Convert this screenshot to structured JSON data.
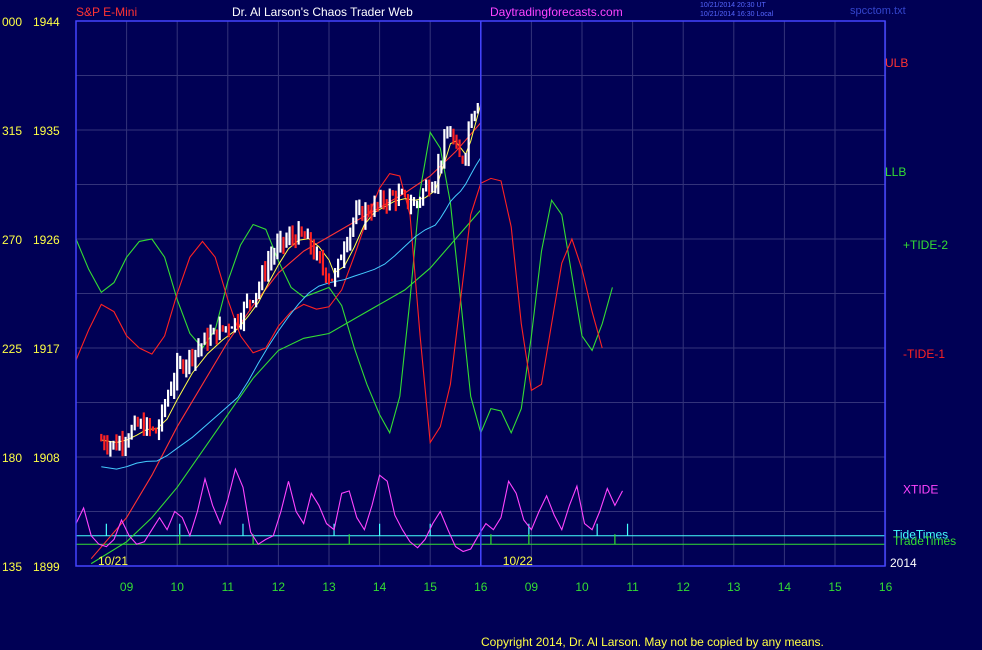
{
  "header": {
    "symbol": "S&P E-Mini",
    "site": "Dr. Al Larson's Chaos Trader Web",
    "url": "Daytradingforecasts.com",
    "stamp1": "10/21/2014 20:30 UT",
    "stamp2": "10/21/2014 16:30 Local",
    "file": "spcctom.txt"
  },
  "footer": {
    "copyright": "Copyright 2014, Dr. Al Larson. May not be copied by any means."
  },
  "colors": {
    "background": "#000055",
    "frame": "#4444ff",
    "grid": "#33337a",
    "axis_text": "#ffff44",
    "time_text": "#33dd33",
    "price_bar_up": "#ffffff",
    "price_bar_down": "#ff2222",
    "ulb": "#ff3333",
    "llb": "#33dd33",
    "tide_pos": "#33dd33",
    "tide_neg": "#ff2222",
    "xtide": "#ff44ff",
    "tide_times": "#44ffff",
    "trade_times": "#33dd33",
    "avg_yellow": "#ffff44",
    "avg_cyan": "#44ccff"
  },
  "chart_data": {
    "type": "line",
    "y_ticks": [
      {
        "left": "000",
        "price": "1944",
        "value": 1944
      },
      {
        "left": "315",
        "price": "1935",
        "value": 1935
      },
      {
        "left": "270",
        "price": "1926",
        "value": 1926
      },
      {
        "left": "225",
        "price": "1917",
        "value": 1917
      },
      {
        "left": "180",
        "price": "1908",
        "value": 1908
      },
      {
        "left": "135",
        "price": "1899",
        "value": 1899
      }
    ],
    "ylim": [
      1899,
      1944
    ],
    "x_ticks": [
      "09",
      "10",
      "11",
      "12",
      "13",
      "14",
      "15",
      "16",
      "09",
      "10",
      "11",
      "12",
      "13",
      "14",
      "15",
      "16"
    ],
    "date_labels": [
      "10/21",
      "10/22"
    ],
    "year_label": "2014",
    "divider_at": 8,
    "grid": true,
    "price": {
      "description": "intraday close path from 08:30 on 10/21",
      "points": [
        [
          8.5,
          1909.4
        ],
        [
          8.8,
          1909.0
        ],
        [
          9.0,
          1909.8
        ],
        [
          9.2,
          1910.6
        ],
        [
          9.4,
          1910.4
        ],
        [
          9.6,
          1910.0
        ],
        [
          9.8,
          1913.0
        ],
        [
          10.0,
          1915.2
        ],
        [
          10.3,
          1916.6
        ],
        [
          10.6,
          1917.8
        ],
        [
          10.9,
          1918.6
        ],
        [
          11.2,
          1919.4
        ],
        [
          11.4,
          1920.8
        ],
        [
          11.6,
          1922.0
        ],
        [
          11.8,
          1924.2
        ],
        [
          12.0,
          1925.4
        ],
        [
          12.2,
          1926.0
        ],
        [
          12.4,
          1926.3
        ],
        [
          12.6,
          1925.8
        ],
        [
          12.8,
          1924.0
        ],
        [
          13.0,
          1923.0
        ],
        [
          13.1,
          1922.6
        ],
        [
          13.3,
          1925.6
        ],
        [
          13.5,
          1927.8
        ],
        [
          13.7,
          1928.2
        ],
        [
          13.9,
          1928.6
        ],
        [
          14.1,
          1929.2
        ],
        [
          14.3,
          1929.6
        ],
        [
          14.5,
          1929.2
        ],
        [
          14.7,
          1928.8
        ],
        [
          14.9,
          1930.2
        ],
        [
          15.1,
          1931.0
        ],
        [
          15.2,
          1932.6
        ],
        [
          15.3,
          1934.0
        ],
        [
          15.4,
          1935.0
        ],
        [
          15.5,
          1933.2
        ],
        [
          15.6,
          1932.4
        ],
        [
          15.7,
          1933.4
        ],
        [
          15.8,
          1936.4
        ],
        [
          15.9,
          1937.0
        ],
        [
          16.0,
          1938.0
        ]
      ]
    },
    "series": [
      {
        "name": "ULB",
        "points": [
          [
            8.3,
            1899.6
          ],
          [
            9.0,
            1903.0
          ],
          [
            9.5,
            1906.5
          ],
          [
            10,
            1910.5
          ],
          [
            10.5,
            1914.0
          ],
          [
            11,
            1917.5
          ],
          [
            11.5,
            1920.5
          ],
          [
            12,
            1923.2
          ],
          [
            12.5,
            1925.0
          ],
          [
            13,
            1926.2
          ],
          [
            13.5,
            1927.4
          ],
          [
            14,
            1928.6
          ],
          [
            14.5,
            1929.8
          ],
          [
            15,
            1931.2
          ],
          [
            15.5,
            1933.2
          ],
          [
            16,
            1935.6
          ]
        ]
      },
      {
        "name": "LLB",
        "points": [
          [
            8.3,
            1899.2
          ],
          [
            9.0,
            1901.0
          ],
          [
            9.5,
            1903.0
          ],
          [
            10,
            1905.5
          ],
          [
            10.5,
            1908.5
          ],
          [
            11,
            1911.5
          ],
          [
            11.5,
            1914.5
          ],
          [
            12,
            1916.8
          ],
          [
            12.5,
            1917.8
          ],
          [
            13,
            1918.2
          ],
          [
            13.5,
            1919.4
          ],
          [
            14,
            1920.6
          ],
          [
            14.5,
            1921.8
          ],
          [
            15,
            1923.6
          ],
          [
            15.5,
            1926.0
          ],
          [
            16,
            1928.4
          ]
        ]
      },
      {
        "name": "+TIDE-2",
        "points": [
          [
            8.0,
            1926.0
          ],
          [
            8.25,
            1923.5
          ],
          [
            8.5,
            1921.6
          ],
          [
            8.75,
            1922.4
          ],
          [
            9.0,
            1924.5
          ],
          [
            9.25,
            1925.8
          ],
          [
            9.5,
            1926.0
          ],
          [
            9.75,
            1924.5
          ],
          [
            10.0,
            1921.0
          ],
          [
            10.25,
            1918.2
          ],
          [
            10.5,
            1917.0
          ],
          [
            10.75,
            1918.5
          ],
          [
            11.0,
            1922.5
          ],
          [
            11.25,
            1925.5
          ],
          [
            11.5,
            1927.2
          ],
          [
            11.75,
            1926.8
          ],
          [
            12.0,
            1924.2
          ],
          [
            12.25,
            1922.0
          ],
          [
            12.5,
            1921.2
          ],
          [
            12.75,
            1921.6
          ],
          [
            13.0,
            1922.0
          ],
          [
            13.25,
            1920.5
          ],
          [
            13.5,
            1917.0
          ],
          [
            13.75,
            1914.0
          ],
          [
            14.0,
            1911.5
          ],
          [
            14.2,
            1910.0
          ],
          [
            14.4,
            1913.0
          ],
          [
            14.6,
            1921.0
          ],
          [
            14.8,
            1930.0
          ],
          [
            15.0,
            1934.8
          ],
          [
            15.2,
            1933.5
          ],
          [
            15.4,
            1929.0
          ],
          [
            15.6,
            1921.0
          ],
          [
            15.8,
            1913.0
          ],
          [
            16.0,
            1910.0
          ],
          [
            16.2,
            1912.0
          ],
          [
            16.4,
            1911.8
          ],
          [
            16.6,
            1910.0
          ],
          [
            16.8,
            1912.0
          ],
          [
            17.0,
            1918.0
          ],
          [
            17.2,
            1925.0
          ],
          [
            17.4,
            1929.2
          ],
          [
            17.6,
            1928.0
          ],
          [
            17.8,
            1923.0
          ],
          [
            18.0,
            1918.0
          ],
          [
            18.2,
            1916.8
          ],
          [
            18.4,
            1919.0
          ],
          [
            18.6,
            1922.0
          ]
        ]
      },
      {
        "name": "-TIDE-1",
        "points": [
          [
            8.0,
            1916.0
          ],
          [
            8.25,
            1918.5
          ],
          [
            8.5,
            1920.6
          ],
          [
            8.75,
            1920.0
          ],
          [
            9.0,
            1918.0
          ],
          [
            9.25,
            1917.0
          ],
          [
            9.5,
            1916.5
          ],
          [
            9.75,
            1918.0
          ],
          [
            10.0,
            1921.5
          ],
          [
            10.25,
            1924.5
          ],
          [
            10.5,
            1925.8
          ],
          [
            10.75,
            1924.5
          ],
          [
            11.0,
            1921.0
          ],
          [
            11.25,
            1918.0
          ],
          [
            11.5,
            1916.6
          ],
          [
            11.75,
            1917.0
          ],
          [
            12.0,
            1918.8
          ],
          [
            12.25,
            1920.0
          ],
          [
            12.5,
            1920.6
          ],
          [
            12.75,
            1920.2
          ],
          [
            13.0,
            1920.4
          ],
          [
            13.25,
            1921.8
          ],
          [
            13.5,
            1924.6
          ],
          [
            13.75,
            1927.6
          ],
          [
            14.0,
            1930.2
          ],
          [
            14.2,
            1931.4
          ],
          [
            14.4,
            1931.2
          ],
          [
            14.6,
            1928.0
          ],
          [
            14.8,
            1918.0
          ],
          [
            15.0,
            1909.2
          ],
          [
            15.2,
            1910.5
          ],
          [
            15.4,
            1914.0
          ],
          [
            15.6,
            1921.0
          ],
          [
            15.8,
            1928.0
          ],
          [
            16.0,
            1930.6
          ],
          [
            16.2,
            1931.0
          ],
          [
            16.4,
            1930.8
          ],
          [
            16.6,
            1927.0
          ],
          [
            16.8,
            1919.0
          ],
          [
            17.0,
            1913.5
          ],
          [
            17.2,
            1914.0
          ],
          [
            17.4,
            1919.0
          ],
          [
            17.6,
            1924.0
          ],
          [
            17.8,
            1926.0
          ],
          [
            18.0,
            1923.5
          ],
          [
            18.2,
            1920.0
          ],
          [
            18.4,
            1917.0
          ]
        ]
      },
      {
        "name": "XTIDE",
        "points": [
          [
            8.0,
            1902.5
          ],
          [
            8.15,
            1903.8
          ],
          [
            8.3,
            1901.5
          ],
          [
            8.45,
            1900.8
          ],
          [
            8.6,
            1900.6
          ],
          [
            8.75,
            1901.2
          ],
          [
            8.9,
            1902.8
          ],
          [
            9.05,
            1901.5
          ],
          [
            9.2,
            1900.8
          ],
          [
            9.35,
            1901.0
          ],
          [
            9.5,
            1902.0
          ],
          [
            9.65,
            1903.0
          ],
          [
            9.8,
            1902.0
          ],
          [
            9.95,
            1903.5
          ],
          [
            10.1,
            1903.0
          ],
          [
            10.25,
            1901.5
          ],
          [
            10.4,
            1903.5
          ],
          [
            10.55,
            1906.2
          ],
          [
            10.7,
            1904.0
          ],
          [
            10.85,
            1902.5
          ],
          [
            11.0,
            1904.5
          ],
          [
            11.15,
            1907.0
          ],
          [
            11.3,
            1905.5
          ],
          [
            11.45,
            1901.8
          ],
          [
            11.6,
            1900.8
          ],
          [
            11.75,
            1901.2
          ],
          [
            11.9,
            1901.5
          ],
          [
            12.05,
            1903.5
          ],
          [
            12.2,
            1906.0
          ],
          [
            12.35,
            1903.5
          ],
          [
            12.5,
            1902.5
          ],
          [
            12.65,
            1905.0
          ],
          [
            12.8,
            1904.0
          ],
          [
            12.95,
            1902.5
          ],
          [
            13.1,
            1902.0
          ],
          [
            13.25,
            1905.0
          ],
          [
            13.4,
            1905.2
          ],
          [
            13.55,
            1903.0
          ],
          [
            13.7,
            1902.0
          ],
          [
            13.85,
            1904.0
          ],
          [
            14.0,
            1906.5
          ],
          [
            14.15,
            1906.0
          ],
          [
            14.3,
            1903.2
          ],
          [
            14.45,
            1902.0
          ],
          [
            14.6,
            1901.0
          ],
          [
            14.75,
            1900.5
          ],
          [
            14.9,
            1901.2
          ],
          [
            15.05,
            1902.5
          ],
          [
            15.2,
            1903.5
          ],
          [
            15.35,
            1902.0
          ],
          [
            15.5,
            1900.6
          ],
          [
            15.65,
            1900.2
          ],
          [
            15.8,
            1900.4
          ],
          [
            15.95,
            1901.5
          ],
          [
            16.1,
            1902.5
          ],
          [
            16.25,
            1902.0
          ],
          [
            16.4,
            1903.0
          ],
          [
            16.55,
            1906.0
          ],
          [
            16.7,
            1905.0
          ],
          [
            16.85,
            1902.8
          ],
          [
            17.0,
            1902.0
          ],
          [
            17.15,
            1903.5
          ],
          [
            17.3,
            1904.8
          ],
          [
            17.45,
            1903.2
          ],
          [
            17.6,
            1902.0
          ],
          [
            17.75,
            1904.0
          ],
          [
            17.9,
            1905.6
          ],
          [
            18.05,
            1902.5
          ],
          [
            18.2,
            1902.0
          ],
          [
            18.35,
            1903.5
          ],
          [
            18.5,
            1905.4
          ],
          [
            18.65,
            1904.0
          ],
          [
            18.8,
            1905.2
          ]
        ]
      }
    ],
    "series_labels": [
      {
        "name": "ULB",
        "text": "ULB"
      },
      {
        "name": "LLB",
        "text": "LLB"
      },
      {
        "name": "+TIDE-2",
        "text": "+TIDE-2"
      },
      {
        "name": "-TIDE-1",
        "text": "-TIDE-1"
      },
      {
        "name": "XTIDE",
        "text": "XTIDE"
      }
    ],
    "tide_times": {
      "label": "TideTimes",
      "value": 1901.5
    },
    "trade_times": {
      "label": "TradeTimes",
      "value": 1900.8
    }
  }
}
